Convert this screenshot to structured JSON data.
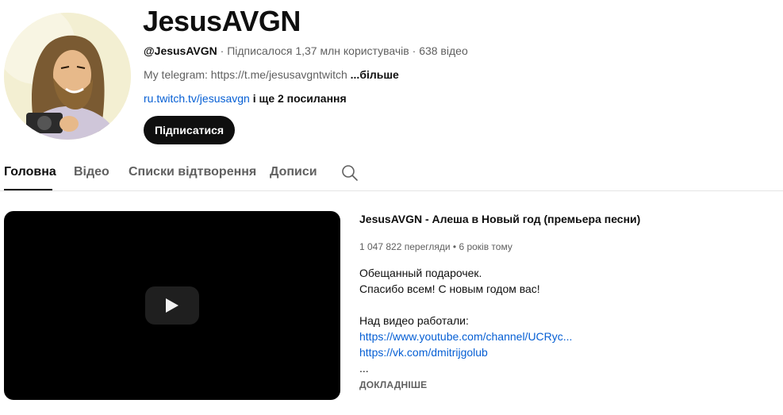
{
  "channel": {
    "name": "JesusAVGN",
    "handle": "@JesusAVGN",
    "subscribers": "Підписалося 1,37 млн користувачів",
    "video_count": "638 відео",
    "separator": " · ",
    "description": "My telegram: https://t.me/jesusavgntwitch",
    "more_label": "...більше",
    "link_text": "ru.twitch.tv/jesusavgn",
    "extra_links": " і ще 2 посилання",
    "subscribe_label": "Підписатися"
  },
  "tabs": [
    {
      "label": "Головна",
      "active": true
    },
    {
      "label": "Відео",
      "active": false
    },
    {
      "label": "Списки відтворення",
      "active": false
    },
    {
      "label": "Дописи",
      "active": false
    }
  ],
  "featured_video": {
    "title": "JesusAVGN - Алеша в Новый год (премьера песни)",
    "views": "1 047 822 перегляди",
    "stats_separator": " • ",
    "age": "6 років тому",
    "description_lines": [
      "Обещанный подарочек.",
      "Спасибо всем! С новым годом вас!",
      "",
      "Над видео работали:"
    ],
    "links": [
      "https://www.youtube.com/channel/UCRyc...",
      "https://vk.com/dmitrijgolub"
    ],
    "ellipsis": "...",
    "more_label": "ДОКЛАДНІШЕ"
  },
  "icons": {
    "search": "search-icon",
    "play": "play-icon"
  },
  "colors": {
    "link": "#065fd4",
    "text": "#0f0f0f",
    "secondary_text": "#606060",
    "subscribe_bg": "#0f0f0f"
  }
}
